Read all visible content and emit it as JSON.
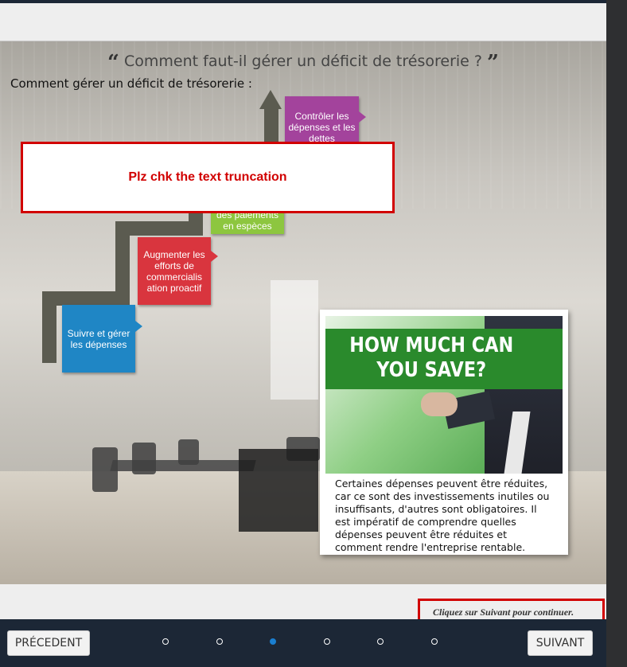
{
  "slide": {
    "title": "Comment faut-il gérer un déficit de trésorerie ?",
    "open_quote": "“",
    "close_quote": "”",
    "subtitle": "Comment gérer un déficit de trésorerie :",
    "steps": [
      {
        "label": "Suivre et gérer les dépenses",
        "color": "#1f86c5"
      },
      {
        "label": "Augmenter les efforts de commercialis ation proactif",
        "color": "#d9353e"
      },
      {
        "label": "des paiements en espèces",
        "color": "#8dc63f"
      },
      {
        "label": "Contrôler les dépenses et les dettes",
        "color": "#a3439c"
      }
    ],
    "promo_image_text": "HOW MUCH CAN YOU SAVE?",
    "card_text": "Certaines dépenses peuvent être réduites, car ce sont des investissements inutiles ou insuffisants, d'autres sont obligatoires. Il est impératif de comprendre quelles dépenses peuvent être réduites et comment rendre l'entreprise rentable."
  },
  "review_note": "Plz chk the text truncation",
  "continue_hint": "Cliquez sur Suivant pour continuer.",
  "nav": {
    "prev_label": "PRÉCEDENT",
    "next_label": "SUIVANT",
    "page_count": 6,
    "active_page": 3
  }
}
